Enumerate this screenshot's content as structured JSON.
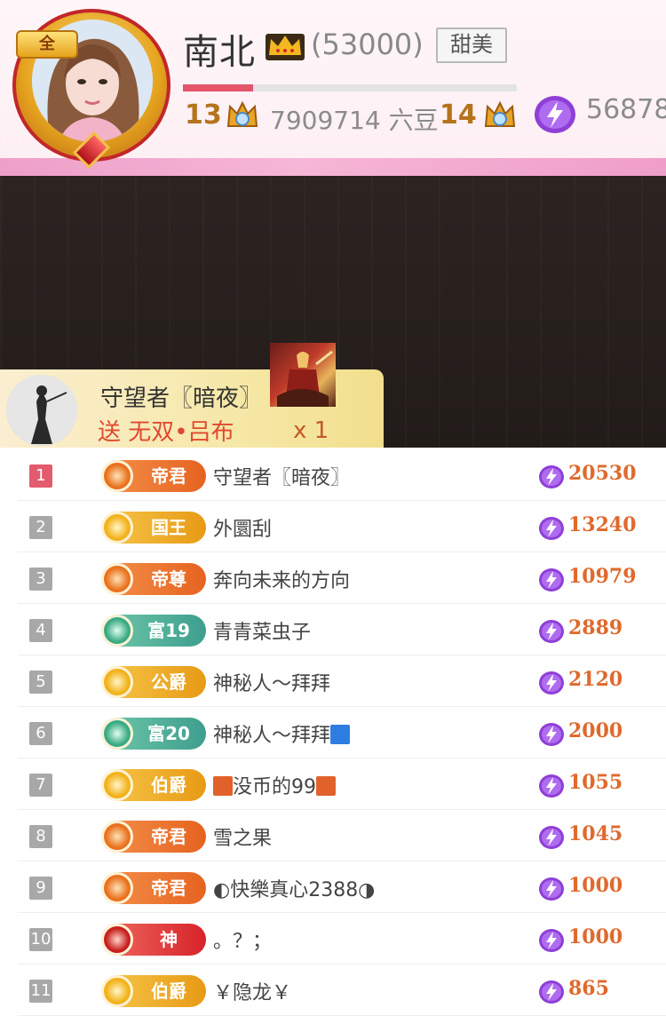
{
  "anchor": {
    "name": "南北",
    "fans": "(53000)",
    "tag": "甜美",
    "frame_tag": "全",
    "level_current": "13",
    "level_next": "14",
    "exp": "7909714 六豆",
    "coins": "56878",
    "progress_fraction": 0.21
  },
  "gift": {
    "sender": "守望者〖暗夜〗",
    "message": "送 无双•吕布",
    "count": "x 1"
  },
  "colors": {
    "accent": "#e4546a",
    "score": "#e0692c",
    "header_band": "#f6b6d6",
    "stage": "#2c2421"
  },
  "rank_list": [
    {
      "rank": "1",
      "badge": "帝君",
      "badge_style": "orange",
      "name": "守望者〖暗夜〗",
      "score": "20530"
    },
    {
      "rank": "2",
      "badge": "国王",
      "badge_style": "gold",
      "name": "外圜刮",
      "score": "13240"
    },
    {
      "rank": "3",
      "badge": "帝尊",
      "badge_style": "orange",
      "name": "奔向未来的方向",
      "score": "10979"
    },
    {
      "rank": "4",
      "badge": "富19",
      "badge_style": "teal",
      "name": "青青菜虫子",
      "score": "2889"
    },
    {
      "rank": "5",
      "badge": "公爵",
      "badge_style": "gold",
      "name": "神秘人～拜拜",
      "score": "2120"
    },
    {
      "rank": "6",
      "badge": "富20",
      "badge_style": "teal",
      "name": "神秘人～拜拜",
      "score": "2000",
      "suffix_icon": "blue"
    },
    {
      "rank": "7",
      "badge": "伯爵",
      "badge_style": "gold",
      "name": "没币的99",
      "score": "1055",
      "prefix_icon": "orange",
      "suffix_icon": "orange"
    },
    {
      "rank": "8",
      "badge": "帝君",
      "badge_style": "orange",
      "name": "雪之果",
      "score": "1045"
    },
    {
      "rank": "9",
      "badge": "帝君",
      "badge_style": "orange",
      "name": "◐快樂真心2388◑",
      "score": "1000"
    },
    {
      "rank": "10",
      "badge": "神",
      "badge_style": "red",
      "name": "。？；",
      "score": "1000"
    },
    {
      "rank": "11",
      "badge": "伯爵",
      "badge_style": "gold",
      "name": "￥隐龙￥",
      "score": "865"
    }
  ]
}
